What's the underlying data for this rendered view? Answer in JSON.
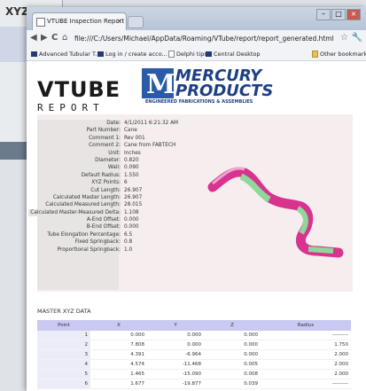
{
  "background_window": {
    "title": "XYZ"
  },
  "browser": {
    "tab_title": "VTUBE Inspection Report",
    "tab_close": "×",
    "address": "file:///C:/Users/Michael/AppData/Roaming/VTube/report/report_generated.html",
    "nav": {
      "back": "◀",
      "forward": "▶",
      "reload": "C",
      "home": "⌂",
      "star": "☆",
      "wrench": "🔧"
    },
    "window_buttons": {
      "minimize": "–",
      "maximize": "□",
      "close": "×"
    },
    "bookmarks": [
      "Advanced Tubular T...",
      "Log in / create acco...",
      "Delphi tips",
      "Central Desktop"
    ],
    "other_bookmarks": "Other bookmarks"
  },
  "logos": {
    "vtube_top": "VTUBE",
    "vtube_bottom": "REPORT",
    "mercury_mark": "M",
    "mercury_line1": "MERCURY",
    "mercury_line2": "PRODUCTS",
    "mercury_tagline": "ENGINEERED FABRICATIONS & ASSEMBLIES"
  },
  "report_fields": [
    {
      "label": "Date:",
      "value": "4/1/2011 6:21:32 AM"
    },
    {
      "label": "Part Number:",
      "value": "Cane"
    },
    {
      "label": "Comment 1:",
      "value": "Rev 001"
    },
    {
      "label": "Comment 2:",
      "value": "Cane from FABTECH"
    },
    {
      "label": "Unit:",
      "value": "Inches"
    },
    {
      "label": "Diameter:",
      "value": "0.820"
    },
    {
      "label": "Wall:",
      "value": "0.090"
    },
    {
      "label": "Default Radius:",
      "value": "1.550"
    },
    {
      "label": "XYZ Points:",
      "value": "6"
    },
    {
      "label": "Cut Length:",
      "value": "26.907"
    },
    {
      "label": "Calculated Master Length:",
      "value": "26.907"
    },
    {
      "label": "Calculated Measured Length:",
      "value": "28.015"
    },
    {
      "label": "Calculated Master-Measured Delta:",
      "value": "1.108"
    },
    {
      "label": "A-End Offset:",
      "value": "0.000"
    },
    {
      "label": "B-End Offset:",
      "value": "0.000"
    },
    {
      "label": "Tube Elongation Percentage:",
      "value": "6.5"
    },
    {
      "label": "Fixed Springback:",
      "value": "0.8"
    },
    {
      "label": "Proportional Springback:",
      "value": "1.0"
    }
  ],
  "xyz_section_title": "MASTER XYZ DATA",
  "xyz_table": {
    "headers": [
      "Point",
      "X",
      "Y",
      "Z",
      "Radius"
    ],
    "rows": [
      [
        "1",
        "0.000",
        "0.000",
        "0.000",
        "---------"
      ],
      [
        "2",
        "7.808",
        "0.000",
        "0.000",
        "1.750"
      ],
      [
        "3",
        "4.391",
        "-6.964",
        "0.000",
        "2.000"
      ],
      [
        "4",
        "4.574",
        "-11.468",
        "0.005",
        "2.000"
      ],
      [
        "5",
        "1.465",
        "-15.090",
        "0.008",
        "2.000"
      ],
      [
        "6",
        "1.677",
        "-19.877",
        "0.039",
        "---------"
      ]
    ]
  },
  "colors": {
    "tube_pink": "#d8338f",
    "tube_green": "#8fd89a",
    "table_header": "#c9c9f2"
  }
}
